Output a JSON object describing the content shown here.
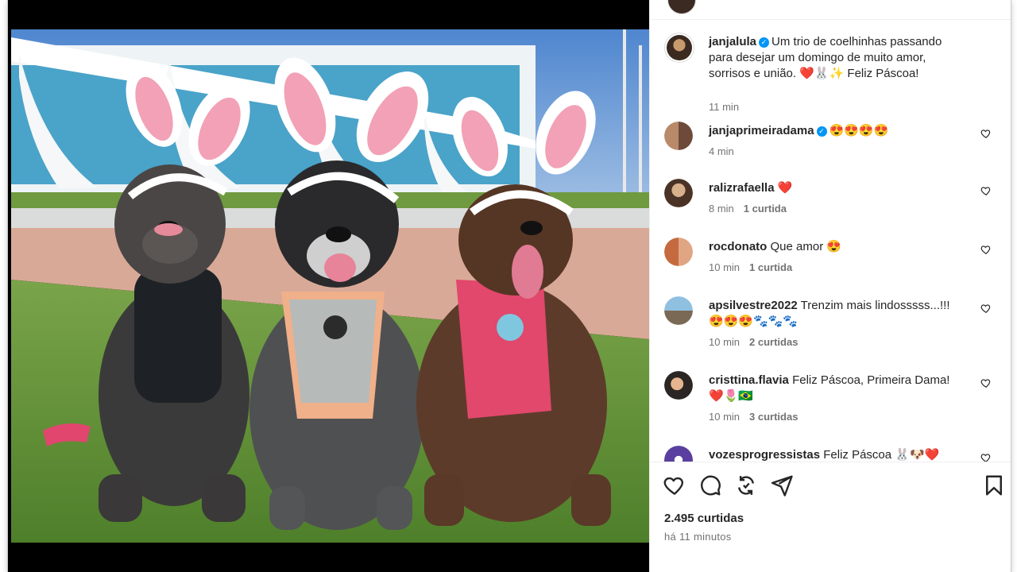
{
  "post": {
    "caption": {
      "username": "janjalula",
      "text_line1": "Um trio de coelhinhas passando",
      "text_line2": "para desejar um domingo de muito amor,",
      "text_line3": "sorrisos e união. ❤️🐰✨ Feliz Páscoa!",
      "time": "11 min"
    },
    "comments": [
      {
        "username": "janjaprimeiradama",
        "verified": true,
        "text": "😍😍😍😍",
        "time": "4 min",
        "likes": ""
      },
      {
        "username": "ralizrafaella",
        "verified": false,
        "text": "❤️",
        "time": "8 min",
        "likes": "1 curtida"
      },
      {
        "username": "rocdonato",
        "verified": false,
        "text": "Que amor 😍",
        "time": "10 min",
        "likes": "1 curtida"
      },
      {
        "username": "apsilvestre2022",
        "verified": false,
        "text": "Trenzim mais lindosssss...!!!",
        "text2": "😍😍😍🐾🐾🐾",
        "time": "10 min",
        "likes": "2 curtidas"
      },
      {
        "username": "cristtina.flavia",
        "verified": false,
        "text": "Feliz Páscoa, Primeira Dama!",
        "text2": "❤️🌷🇧🇷",
        "time": "10 min",
        "likes": "3 curtidas"
      },
      {
        "username": "vozesprogressistas",
        "verified": false,
        "text": "Feliz Páscoa 🐰🐶❤️",
        "time": "",
        "likes": ""
      }
    ],
    "likes_count": "2.495 curtidas",
    "posted_ago": "há 11 minutos"
  },
  "icons": {
    "like": "heart-icon",
    "comment": "comment-bubble-icon",
    "repost": "repost-icon",
    "share": "send-icon",
    "save": "bookmark-icon",
    "verified": "verified-badge-icon"
  },
  "colors": {
    "accent_blue": "#0095f6",
    "muted_text": "#737373",
    "text": "#262626"
  }
}
